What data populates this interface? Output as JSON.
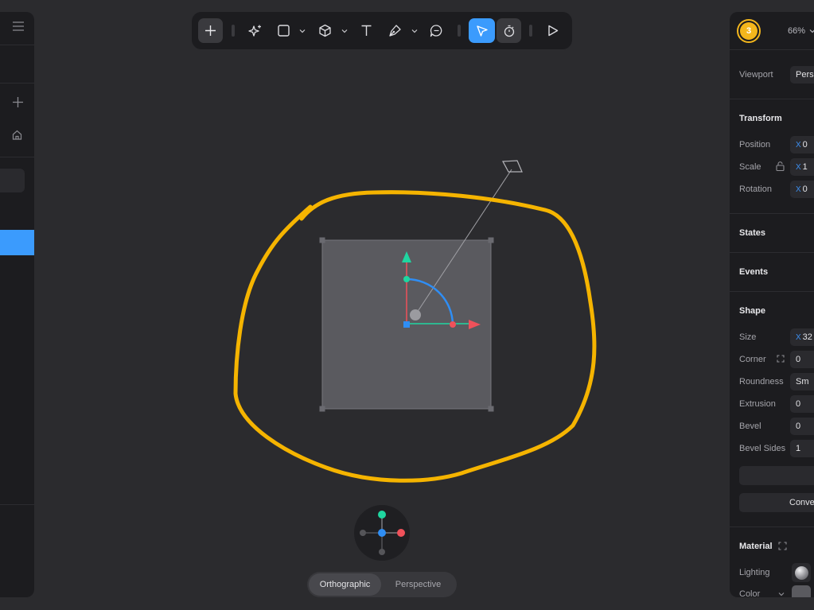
{
  "left_panel": {
    "icons": [
      "menu-icon",
      "plus-icon",
      "home-icon"
    ]
  },
  "toolbar": {
    "tools": [
      "add",
      "ai-sparkle",
      "rectangle",
      "cube",
      "text",
      "pen",
      "comment",
      "select",
      "timer",
      "play"
    ],
    "active_tool": "select",
    "accent": "#3b9bfd"
  },
  "canvas": {
    "annotation_color": "#f5b400",
    "object_fill": "#5a5a5f",
    "gizmo_colors": {
      "x": "#f0515a",
      "y": "#1fd6a0",
      "z": "#2f8ef5"
    }
  },
  "view_switch": {
    "orthographic": "Orthographic",
    "perspective": "Perspective",
    "active": "Orthographic"
  },
  "right_panel": {
    "avatar_initial": "3",
    "zoom": "66%",
    "viewport_label": "Viewport",
    "viewport_value": "Pers",
    "transform_title": "Transform",
    "position_label": "Position",
    "position_x_axis": "X",
    "position_x": "0",
    "scale_label": "Scale",
    "scale_x_axis": "X",
    "scale_x": "1",
    "rotation_label": "Rotation",
    "rotation_x_axis": "X",
    "rotation_x": "0",
    "states_title": "States",
    "events_title": "Events",
    "shape_title": "Shape",
    "size_label": "Size",
    "size_x_axis": "X",
    "size_x": "32",
    "corner_label": "Corner",
    "corner_value": "0",
    "roundness_label": "Roundness",
    "roundness_value": "Sm",
    "extrusion_label": "Extrusion",
    "extrusion_value": "0",
    "bevel_label": "Bevel",
    "bevel_value": "0",
    "bevel_sides_label": "Bevel Sides",
    "bevel_sides_value": "1",
    "convert_label": "Conve",
    "material_title": "Material",
    "lighting_label": "Lighting",
    "color_label": "Color"
  }
}
